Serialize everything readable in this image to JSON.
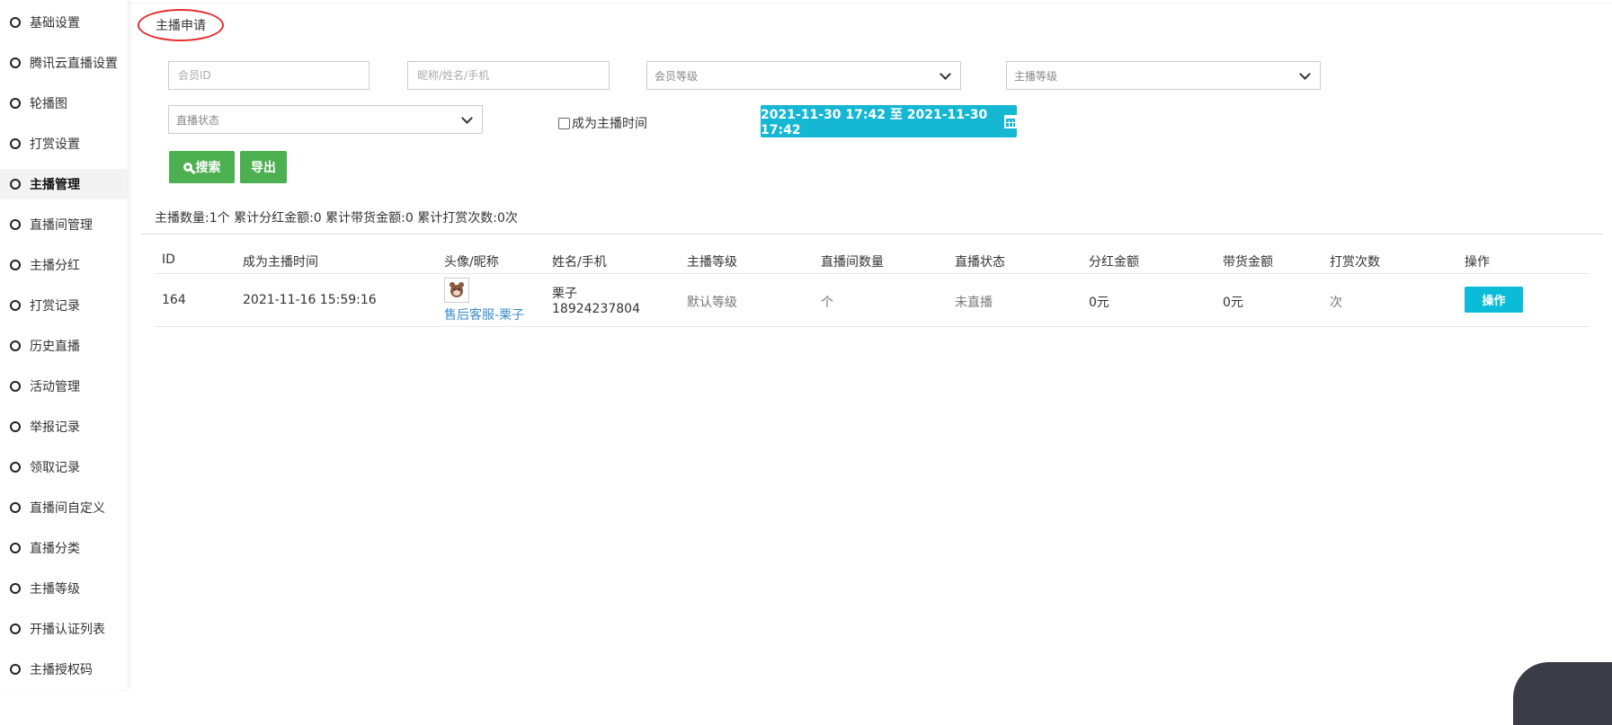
{
  "sidebar": {
    "items": [
      {
        "label": "基础设置"
      },
      {
        "label": "腾讯云直播设置"
      },
      {
        "label": "轮播图"
      },
      {
        "label": "打赏设置"
      },
      {
        "label": "主播管理",
        "active": true
      },
      {
        "label": "直播间管理"
      },
      {
        "label": "主播分红"
      },
      {
        "label": "打赏记录"
      },
      {
        "label": "历史直播"
      },
      {
        "label": "活动管理"
      },
      {
        "label": "举报记录"
      },
      {
        "label": "领取记录"
      },
      {
        "label": "直播间自定义"
      },
      {
        "label": "直播分类"
      },
      {
        "label": "主播等级"
      },
      {
        "label": "开播认证列表"
      },
      {
        "label": "主播授权码"
      }
    ]
  },
  "tab": {
    "label": "主播申请"
  },
  "filters": {
    "member_id_placeholder": "会员ID",
    "name_placeholder": "昵称/姓名/手机",
    "member_level": "会员等级",
    "anchor_level": "主播等级",
    "live_status": "直播状态",
    "become_anchor_time_label": "成为主播时间",
    "date_range": "2021-11-30 17:42 至 2021-11-30 17:42",
    "search_label": "搜索",
    "export_label": "导出"
  },
  "stats": {
    "text": "主播数量:1个 累计分红金额:0 累计带货金额:0 累计打赏次数:0次"
  },
  "table": {
    "headers": {
      "id": "ID",
      "time": "成为主播时间",
      "avatar": "头像/昵称",
      "name": "姓名/手机",
      "level": "主播等级",
      "rooms": "直播间数量",
      "status": "直播状态",
      "dividend": "分红金额",
      "goods": "带货金额",
      "tips": "打赏次数",
      "op": "操作"
    },
    "rows": [
      {
        "id": "164",
        "time": "2021-11-16 15:59:16",
        "nickname": "售后客服-栗子",
        "name": "栗子",
        "phone": "18924237804",
        "level": "默认等级",
        "rooms": "个",
        "status": "未直播",
        "dividend": "0元",
        "goods": "0元",
        "tips": "次",
        "op_label": "操作"
      }
    ]
  },
  "colors": {
    "accent_cyan": "#16b7d3",
    "green": "#4caf50",
    "tab_ring": "#e52b2b",
    "link": "#3a8cc9"
  }
}
